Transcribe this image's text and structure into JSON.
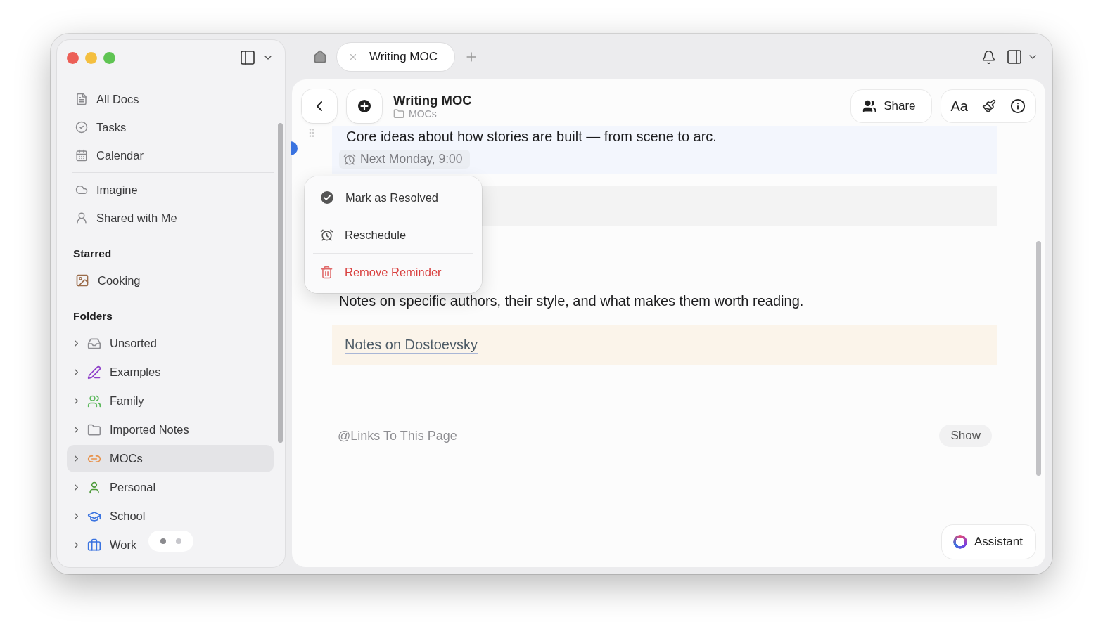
{
  "sidebar": {
    "nav_groups": [
      [
        {
          "label": "All Docs"
        },
        {
          "label": "Tasks"
        },
        {
          "label": "Calendar"
        }
      ],
      [
        {
          "label": "Imagine"
        },
        {
          "label": "Shared with Me"
        }
      ]
    ],
    "starred": {
      "title": "Starred",
      "items": [
        {
          "label": "Cooking"
        }
      ]
    },
    "folders": {
      "title": "Folders",
      "items": [
        {
          "label": "Unsorted",
          "color": "#8e8e93",
          "selected": false
        },
        {
          "label": "Examples",
          "color": "#8e3fc9",
          "selected": false
        },
        {
          "label": "Family",
          "color": "#5cb85c",
          "selected": false
        },
        {
          "label": "Imported Notes",
          "color": "#8e8e93",
          "selected": false
        },
        {
          "label": "MOCs",
          "color": "#e8914a",
          "selected": true
        },
        {
          "label": "Personal",
          "color": "#4e9a3a",
          "selected": false
        },
        {
          "label": "School",
          "color": "#3a73e0",
          "selected": false
        },
        {
          "label": "Work",
          "color": "#3a73e0",
          "selected": false
        }
      ]
    },
    "pager": [
      {
        "selected": true
      },
      {
        "selected": false
      }
    ]
  },
  "tabs": [
    {
      "label": "Writing MOC",
      "selected": true
    }
  ],
  "doc": {
    "title": "Writing MOC",
    "folder": "MOCs",
    "share": "Share",
    "font_button": "Aa",
    "blocks": [
      {
        "kind": "reminder",
        "text": "Core ideas about how stories are built — from scene to arc.",
        "reminder": "Next Monday, 9:00"
      },
      {
        "kind": "bar"
      },
      {
        "kind": "paragraph",
        "text": "Notes on specific authors, their style, and what makes them worth reading."
      },
      {
        "kind": "callout",
        "link": "Notes on Dostoevsky"
      }
    ],
    "backlinks": {
      "title": "@Links To This Page",
      "button": "Show"
    },
    "assistant": "Assistant"
  },
  "menu": [
    {
      "label": "Mark as Resolved",
      "kind": "resolve"
    },
    {
      "label": "Reschedule",
      "kind": "reschedule"
    },
    {
      "label": "Remove Reminder",
      "kind": "remove"
    }
  ]
}
